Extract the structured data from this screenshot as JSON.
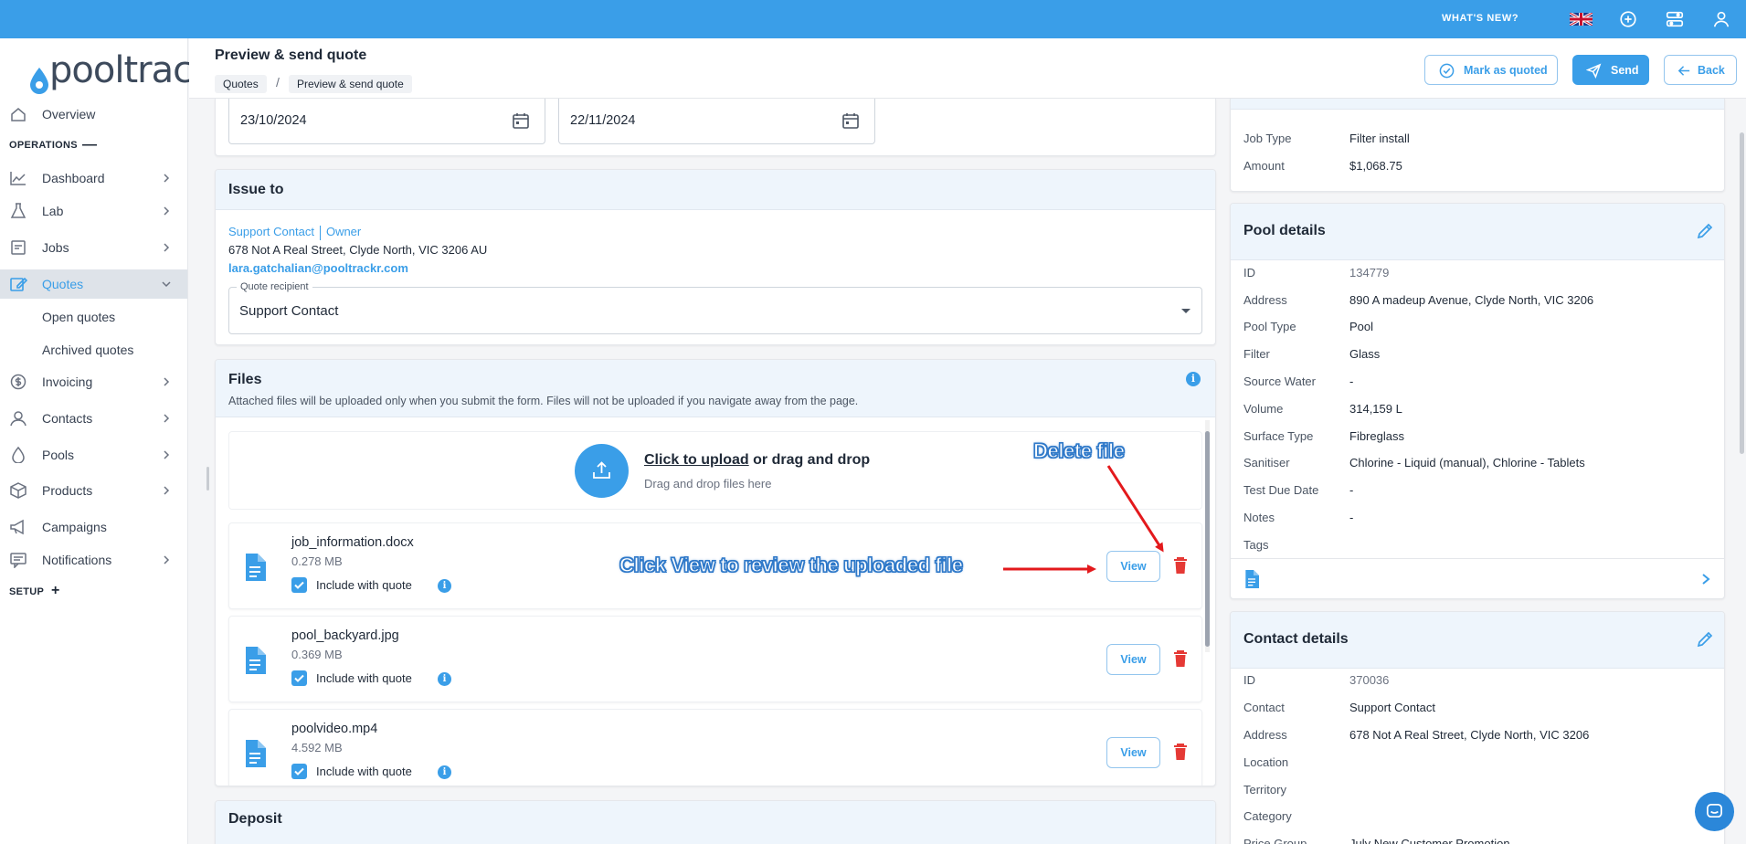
{
  "topbar": {
    "whats_new": "WHAT'S NEW?",
    "icons": [
      "uk-flag-icon",
      "add-circle-icon",
      "settings-sliders-icon",
      "user-icon"
    ]
  },
  "brand": {
    "logo_text": "pooltrackr",
    "accent": "#3a9ee8"
  },
  "sidebar": {
    "overview": "Overview",
    "operations_label": "OPERATIONS",
    "operations_symbol": "—",
    "items": [
      {
        "label": "Dashboard",
        "icon": "chart-line-icon"
      },
      {
        "label": "Lab",
        "icon": "flask-icon"
      },
      {
        "label": "Jobs",
        "icon": "clipboard-icon"
      },
      {
        "label": "Quotes",
        "icon": "quote-edit-icon"
      },
      {
        "label": "Invoicing",
        "icon": "dollar-circle-icon"
      },
      {
        "label": "Contacts",
        "icon": "person-icon"
      },
      {
        "label": "Pools",
        "icon": "droplet-icon"
      },
      {
        "label": "Products",
        "icon": "box-icon"
      },
      {
        "label": "Campaigns",
        "icon": "megaphone-icon"
      },
      {
        "label": "Notifications",
        "icon": "message-icon"
      }
    ],
    "quotes_sub": [
      "Open quotes",
      "Archived quotes"
    ],
    "setup_label": "SETUP",
    "setup_symbol": "+"
  },
  "header": {
    "title": "Preview & send quote",
    "breadcrumb": [
      "Quotes",
      "/",
      "Preview & send quote"
    ],
    "mark_quoted": "Mark as quoted",
    "send": "Send",
    "back": "Back"
  },
  "dates": {
    "issued": "23/10/2024",
    "expiry": "22/11/2024"
  },
  "issue_to": {
    "title": "Issue to",
    "contact": "Support Contact",
    "role": "Owner",
    "address": "678 Not A Real Street, Clyde North, VIC 3206 AU",
    "email": "lara.gatchalian@pooltrackr.com",
    "recipient_label": "Quote recipient",
    "recipient_value": "Support Contact"
  },
  "files": {
    "title": "Files",
    "subtitle": "Attached files will be uploaded only when you submit the form. Files will not be uploaded if you navigate away from the page.",
    "upload_link": "Click to upload",
    "upload_rest": " or drag and drop",
    "upload_sub": "Drag and drop files here",
    "include_label": "Include with quote",
    "view_label": "View",
    "list": [
      {
        "name": "job_information.docx",
        "size": "0.278 MB",
        "included": true
      },
      {
        "name": "pool_backyard.jpg",
        "size": "0.369 MB",
        "included": true
      },
      {
        "name": "poolvideo.mp4",
        "size": "4.592 MB",
        "included": true
      }
    ]
  },
  "deposit": {
    "title": "Deposit"
  },
  "annotations": {
    "delete": "Delete file",
    "view": "Click View to review the uploaded file",
    "color": "#e3191c"
  },
  "job_summary": {
    "job_type_label": "Job Type",
    "job_type": "Filter install",
    "amount_label": "Amount",
    "amount": "$1,068.75"
  },
  "pool_details": {
    "title": "Pool details",
    "rows": [
      {
        "k": "ID",
        "v": "134779"
      },
      {
        "k": "Address",
        "v": "890 A madeup Avenue, Clyde North, VIC 3206"
      },
      {
        "k": "Pool Type",
        "v": "Pool"
      },
      {
        "k": "Filter",
        "v": "Glass"
      },
      {
        "k": "Source Water",
        "v": "-"
      },
      {
        "k": "Volume",
        "v": "314,159 L"
      },
      {
        "k": "Surface Type",
        "v": "Fibreglass"
      },
      {
        "k": "Sanitiser",
        "v": "Chlorine - Liquid (manual), Chlorine - Tablets"
      },
      {
        "k": "Test Due Date",
        "v": "-"
      },
      {
        "k": "Notes",
        "v": "-"
      },
      {
        "k": "Tags",
        "v": ""
      }
    ]
  },
  "contact_details": {
    "title": "Contact details",
    "rows": [
      {
        "k": "ID",
        "v": "370036"
      },
      {
        "k": "Contact",
        "v": "Support Contact"
      },
      {
        "k": "Address",
        "v": "678 Not A Real Street, Clyde North, VIC 3206"
      },
      {
        "k": "Location",
        "v": ""
      },
      {
        "k": "Territory",
        "v": ""
      },
      {
        "k": "Category",
        "v": ""
      },
      {
        "k": "Price Group",
        "v": "July New Customer Promotion"
      }
    ]
  }
}
